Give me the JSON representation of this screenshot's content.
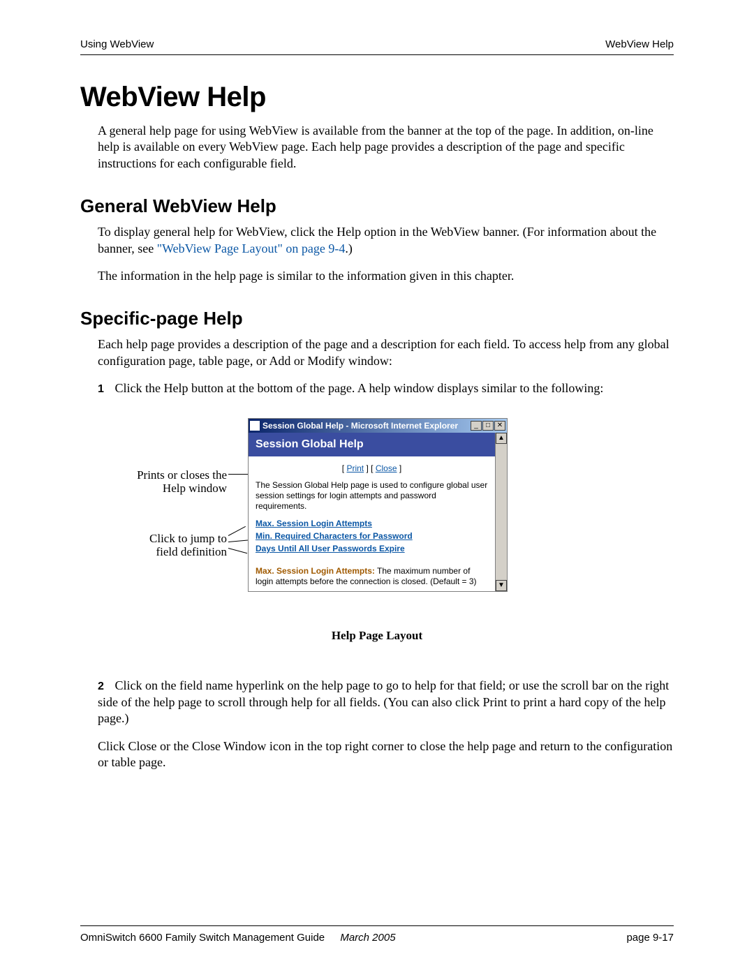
{
  "header": {
    "left": "Using WebView",
    "right": "WebView Help"
  },
  "h1": "WebView Help",
  "intro": "A general help page for using WebView is available from the banner at the top of the page. In addition, on-line help is available on every WebView page. Each help page provides a description of the page and specific instructions for each configurable field.",
  "section1": {
    "title": "General WebView Help",
    "p1_a": "To display general help for WebView, click the Help option in the WebView banner. (For information about the banner, see ",
    "p1_link": "\"WebView Page Layout\" on page 9-4",
    "p1_b": ".)",
    "p2": "The information in the help page is similar to the information given in this chapter."
  },
  "section2": {
    "title": "Specific-page Help",
    "p1": "Each help page provides a description of the page and a description for each field. To access help from any global configuration page, table page, or Add or Modify window:",
    "step1_num": "1",
    "step1": "Click the Help button at the bottom of the page. A help window displays similar to the following:",
    "step2_num": "2",
    "step2": "Click on the field name hyperlink on the help page to go to help for that field; or use the scroll bar on the right side of the help page to scroll through help for all fields. (You can also click Print to print a hard copy of the help page.)",
    "p_close": "Click Close or the Close Window icon in the top right corner to close the help page and return to the configuration or table page."
  },
  "callouts": {
    "c1": "Prints or closes the\nHelp window",
    "c2": "Click to jump to\nfield definition"
  },
  "helpWindow": {
    "title": "Session Global Help - Microsoft Internet Explorer",
    "banner": "Session Global Help",
    "print": "Print",
    "close": "Close",
    "desc": "The Session Global Help page is used to configure global user session settings for login attempts and password requirements.",
    "topics": [
      "Max. Session Login Attempts",
      "Min. Required Characters for Password",
      "Days Until All User Passwords Expire"
    ],
    "def_term": "Max. Session Login Attempts:",
    "def_text": " The maximum number of login attempts before the connection is closed. (Default = 3)"
  },
  "figure_caption": "Help Page Layout",
  "footer": {
    "guide": "OmniSwitch 6600 Family Switch Management Guide",
    "date": "March 2005",
    "page": "page 9-17"
  }
}
